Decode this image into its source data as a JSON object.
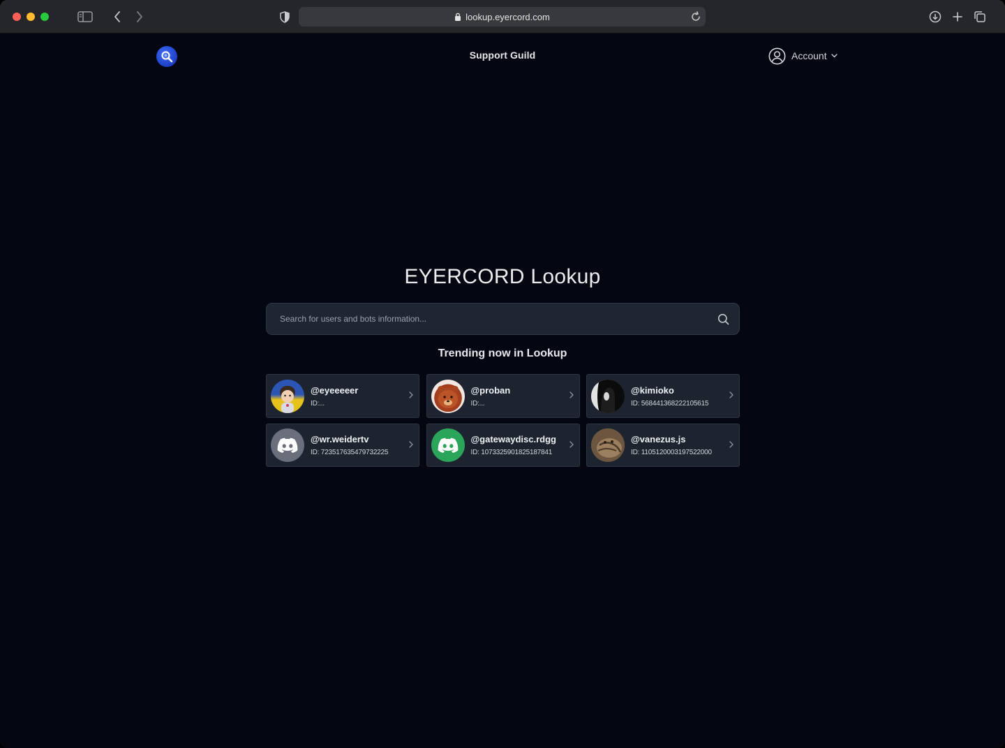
{
  "browser": {
    "url": "lookup.eyercord.com"
  },
  "nav": {
    "center_link": "Support Guild",
    "account_label": "Account"
  },
  "hero": {
    "title": "EYERCORD Lookup"
  },
  "search": {
    "placeholder": "Search for users and bots information..."
  },
  "trending": {
    "title": "Trending now in Lookup",
    "items": [
      {
        "username": "@eyeeeeer",
        "id_text": "ID:...",
        "avatar": "cartoon-avatar"
      },
      {
        "username": "@proban",
        "id_text": "ID:...",
        "avatar": "bear-avatar"
      },
      {
        "username": "@kimioko",
        "id_text": "ID: 568441368222105615",
        "avatar": "dark-portrait-avatar"
      },
      {
        "username": "@wr.weidertv",
        "id_text": "ID: 723517635479732225",
        "avatar": "discord-default-gray-avatar"
      },
      {
        "username": "@gatewaydisc.rdgg",
        "id_text": "ID: 1073325901825187841",
        "avatar": "discord-default-green-avatar"
      },
      {
        "username": "@vanezus.js",
        "id_text": "ID: 1105120003197522000",
        "avatar": "cat-photo-avatar"
      }
    ]
  },
  "colors": {
    "page_bg": "#040711",
    "card_bg": "#1d2430",
    "logo_blue": "#2a4fd6",
    "discord_gray": "#6a6f7b",
    "discord_green": "#2aa55a"
  }
}
